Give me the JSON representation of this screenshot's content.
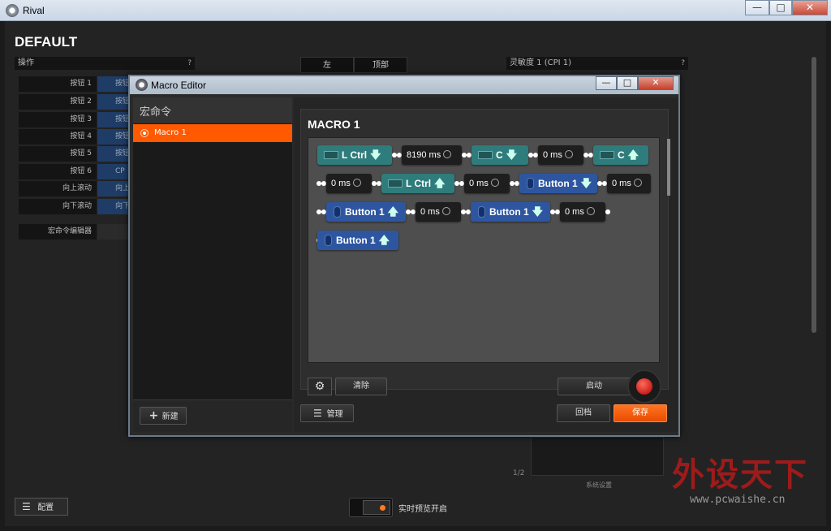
{
  "window": {
    "title": "Rival",
    "controls": [
      "—",
      "□",
      "✕"
    ]
  },
  "page": {
    "title": "DEFAULT"
  },
  "left_section": {
    "title": "操作",
    "help": "?",
    "buttons": [
      {
        "label": "按钮 1",
        "value": "按钮"
      },
      {
        "label": "按钮 2",
        "value": "按钮"
      },
      {
        "label": "按钮 3",
        "value": "按钮"
      },
      {
        "label": "按钮 4",
        "value": "按钮"
      },
      {
        "label": "按钮 5",
        "value": "按钮"
      },
      {
        "label": "按钮 6",
        "value": "CP"
      },
      {
        "label": "向上滚动",
        "value": "向上"
      },
      {
        "label": "向下滚动",
        "value": "向下"
      }
    ],
    "macro_editor_label": "宏命令编辑器"
  },
  "center_tabs": [
    "左",
    "顶部"
  ],
  "right_section": {
    "title": "灵敏度 1 (CPI 1)",
    "help": "?",
    "page_indicator": "1/2",
    "caption": "系统设置"
  },
  "bottom": {
    "config_label": "配置",
    "live_preview_label": "实时预览开启"
  },
  "dialog": {
    "title": "Macro Editor",
    "controls": [
      "—",
      "□",
      "✕"
    ],
    "left_header": "宏命令",
    "selected_macro": "Macro 1",
    "new_button": "新建",
    "macro_name": "MACRO 1",
    "clear_button": "清除",
    "start_button": "启动",
    "manage_button": "管理",
    "revert_button": "回档",
    "save_button": "保存",
    "steps": {
      "r1c1": "L Ctrl",
      "r1c2": "8190 ms",
      "r1c3": "C",
      "r1c4": "0 ms",
      "r1c5": "C",
      "r2c1": "0 ms",
      "r2c2": "L Ctrl",
      "r2c3": "0 ms",
      "r2c4": "Button 1",
      "r2c5": "0 ms",
      "r3c1": "Button 1",
      "r3c2": "0 ms",
      "r3c3": "Button 1",
      "r3c4": "0 ms",
      "r4c1": "Button 1"
    }
  },
  "watermark": {
    "text": "外设天下",
    "url": "www.pcwaishe.cn"
  },
  "colors": {
    "accent": "#ff5a00",
    "key_chip": "#2f7c7c",
    "mouse_chip": "#2e56a0",
    "delay_chip": "#1e1e1e"
  }
}
